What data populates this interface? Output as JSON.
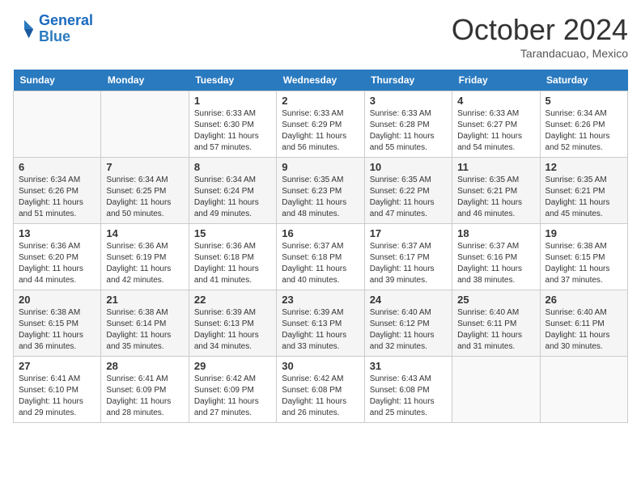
{
  "logo": {
    "line1": "General",
    "line2": "Blue"
  },
  "header": {
    "month": "October 2024",
    "location": "Tarandacuao, Mexico"
  },
  "weekdays": [
    "Sunday",
    "Monday",
    "Tuesday",
    "Wednesday",
    "Thursday",
    "Friday",
    "Saturday"
  ],
  "weeks": [
    [
      {
        "day": "",
        "info": ""
      },
      {
        "day": "",
        "info": ""
      },
      {
        "day": "1",
        "info": "Sunrise: 6:33 AM\nSunset: 6:30 PM\nDaylight: 11 hours and 57 minutes."
      },
      {
        "day": "2",
        "info": "Sunrise: 6:33 AM\nSunset: 6:29 PM\nDaylight: 11 hours and 56 minutes."
      },
      {
        "day": "3",
        "info": "Sunrise: 6:33 AM\nSunset: 6:28 PM\nDaylight: 11 hours and 55 minutes."
      },
      {
        "day": "4",
        "info": "Sunrise: 6:33 AM\nSunset: 6:27 PM\nDaylight: 11 hours and 54 minutes."
      },
      {
        "day": "5",
        "info": "Sunrise: 6:34 AM\nSunset: 6:26 PM\nDaylight: 11 hours and 52 minutes."
      }
    ],
    [
      {
        "day": "6",
        "info": "Sunrise: 6:34 AM\nSunset: 6:26 PM\nDaylight: 11 hours and 51 minutes."
      },
      {
        "day": "7",
        "info": "Sunrise: 6:34 AM\nSunset: 6:25 PM\nDaylight: 11 hours and 50 minutes."
      },
      {
        "day": "8",
        "info": "Sunrise: 6:34 AM\nSunset: 6:24 PM\nDaylight: 11 hours and 49 minutes."
      },
      {
        "day": "9",
        "info": "Sunrise: 6:35 AM\nSunset: 6:23 PM\nDaylight: 11 hours and 48 minutes."
      },
      {
        "day": "10",
        "info": "Sunrise: 6:35 AM\nSunset: 6:22 PM\nDaylight: 11 hours and 47 minutes."
      },
      {
        "day": "11",
        "info": "Sunrise: 6:35 AM\nSunset: 6:21 PM\nDaylight: 11 hours and 46 minutes."
      },
      {
        "day": "12",
        "info": "Sunrise: 6:35 AM\nSunset: 6:21 PM\nDaylight: 11 hours and 45 minutes."
      }
    ],
    [
      {
        "day": "13",
        "info": "Sunrise: 6:36 AM\nSunset: 6:20 PM\nDaylight: 11 hours and 44 minutes."
      },
      {
        "day": "14",
        "info": "Sunrise: 6:36 AM\nSunset: 6:19 PM\nDaylight: 11 hours and 42 minutes."
      },
      {
        "day": "15",
        "info": "Sunrise: 6:36 AM\nSunset: 6:18 PM\nDaylight: 11 hours and 41 minutes."
      },
      {
        "day": "16",
        "info": "Sunrise: 6:37 AM\nSunset: 6:18 PM\nDaylight: 11 hours and 40 minutes."
      },
      {
        "day": "17",
        "info": "Sunrise: 6:37 AM\nSunset: 6:17 PM\nDaylight: 11 hours and 39 minutes."
      },
      {
        "day": "18",
        "info": "Sunrise: 6:37 AM\nSunset: 6:16 PM\nDaylight: 11 hours and 38 minutes."
      },
      {
        "day": "19",
        "info": "Sunrise: 6:38 AM\nSunset: 6:15 PM\nDaylight: 11 hours and 37 minutes."
      }
    ],
    [
      {
        "day": "20",
        "info": "Sunrise: 6:38 AM\nSunset: 6:15 PM\nDaylight: 11 hours and 36 minutes."
      },
      {
        "day": "21",
        "info": "Sunrise: 6:38 AM\nSunset: 6:14 PM\nDaylight: 11 hours and 35 minutes."
      },
      {
        "day": "22",
        "info": "Sunrise: 6:39 AM\nSunset: 6:13 PM\nDaylight: 11 hours and 34 minutes."
      },
      {
        "day": "23",
        "info": "Sunrise: 6:39 AM\nSunset: 6:13 PM\nDaylight: 11 hours and 33 minutes."
      },
      {
        "day": "24",
        "info": "Sunrise: 6:40 AM\nSunset: 6:12 PM\nDaylight: 11 hours and 32 minutes."
      },
      {
        "day": "25",
        "info": "Sunrise: 6:40 AM\nSunset: 6:11 PM\nDaylight: 11 hours and 31 minutes."
      },
      {
        "day": "26",
        "info": "Sunrise: 6:40 AM\nSunset: 6:11 PM\nDaylight: 11 hours and 30 minutes."
      }
    ],
    [
      {
        "day": "27",
        "info": "Sunrise: 6:41 AM\nSunset: 6:10 PM\nDaylight: 11 hours and 29 minutes."
      },
      {
        "day": "28",
        "info": "Sunrise: 6:41 AM\nSunset: 6:09 PM\nDaylight: 11 hours and 28 minutes."
      },
      {
        "day": "29",
        "info": "Sunrise: 6:42 AM\nSunset: 6:09 PM\nDaylight: 11 hours and 27 minutes."
      },
      {
        "day": "30",
        "info": "Sunrise: 6:42 AM\nSunset: 6:08 PM\nDaylight: 11 hours and 26 minutes."
      },
      {
        "day": "31",
        "info": "Sunrise: 6:43 AM\nSunset: 6:08 PM\nDaylight: 11 hours and 25 minutes."
      },
      {
        "day": "",
        "info": ""
      },
      {
        "day": "",
        "info": ""
      }
    ]
  ]
}
